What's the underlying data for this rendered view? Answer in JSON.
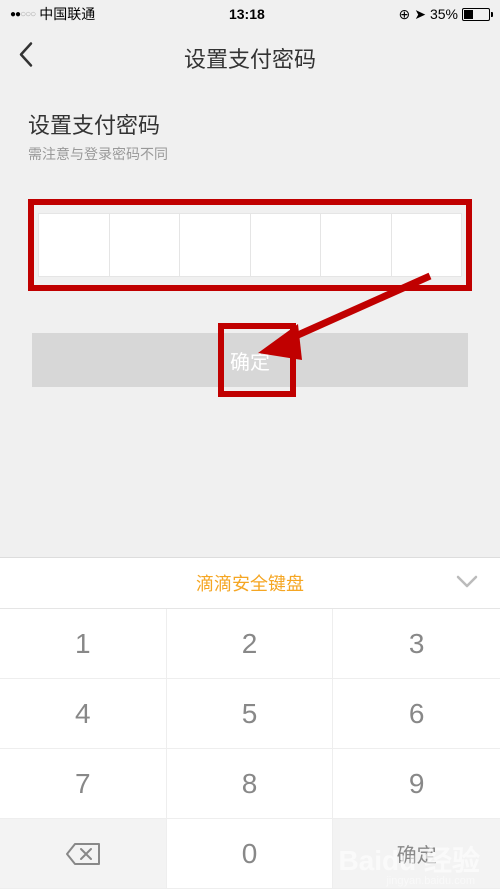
{
  "status_bar": {
    "carrier": "中国联通",
    "time": "13:18",
    "battery_pct": "35%"
  },
  "nav": {
    "title": "设置支付密码"
  },
  "section": {
    "title": "设置支付密码",
    "subtitle": "需注意与登录密码不同"
  },
  "confirm_label": "确定",
  "keyboard": {
    "title": "滴滴安全键盘",
    "keys": [
      "1",
      "2",
      "3",
      "4",
      "5",
      "6",
      "7",
      "8",
      "9",
      "⌫",
      "0",
      "确定"
    ]
  },
  "watermark": {
    "main": "Baidu 经验",
    "sub": "jingyan.baidu.com"
  }
}
